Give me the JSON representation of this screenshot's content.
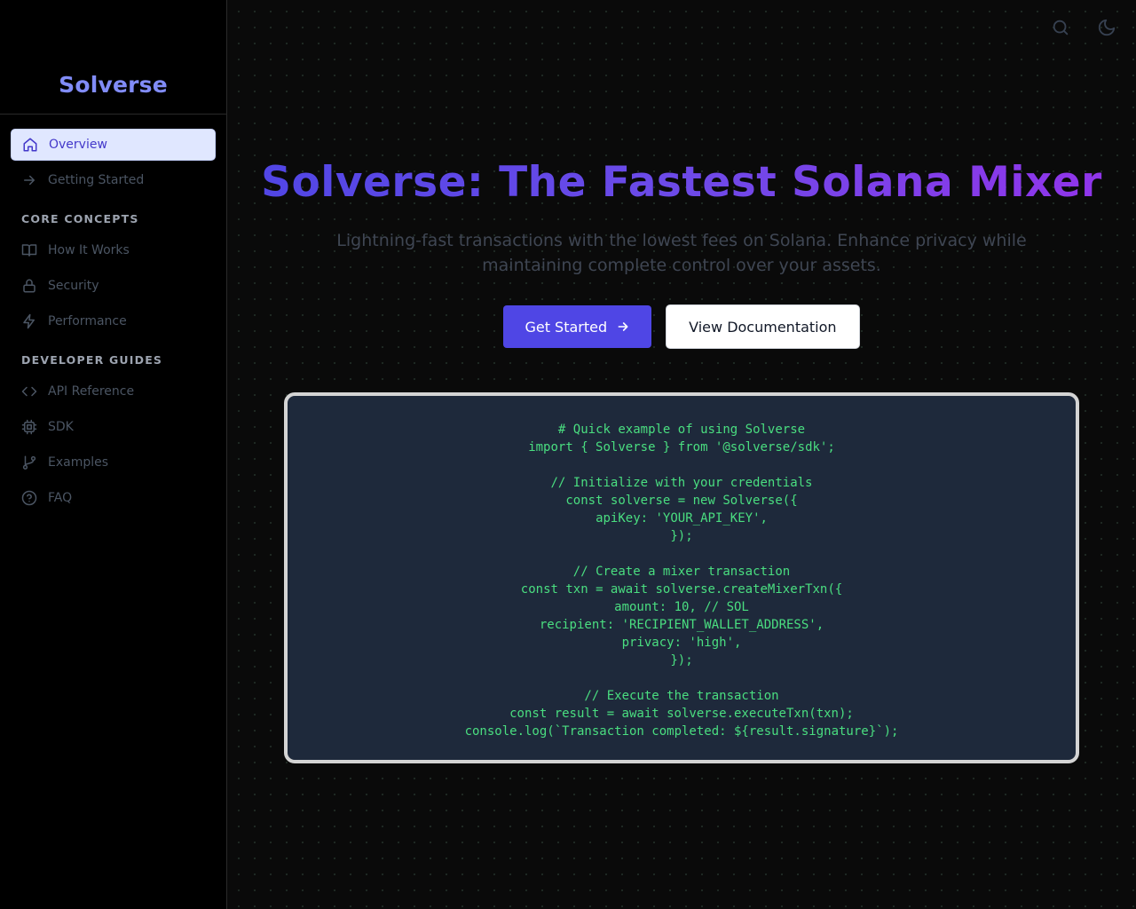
{
  "sidebar": {
    "brand": "Solverse",
    "top_items": [
      {
        "label": "Overview",
        "icon": "home-icon",
        "active": true
      },
      {
        "label": "Getting Started",
        "icon": "arrow-right-icon",
        "active": false
      }
    ],
    "sections": [
      {
        "title": "CORE CONCEPTS",
        "items": [
          {
            "label": "How It Works",
            "icon": "book-icon"
          },
          {
            "label": "Security",
            "icon": "lock-icon"
          },
          {
            "label": "Performance",
            "icon": "lightning-icon"
          }
        ]
      },
      {
        "title": "DEVELOPER GUIDES",
        "items": [
          {
            "label": "API Reference",
            "icon": "code-icon"
          },
          {
            "label": "SDK",
            "icon": "chip-icon"
          },
          {
            "label": "Examples",
            "icon": "git-branch-icon"
          },
          {
            "label": "FAQ",
            "icon": "help-circle-icon"
          }
        ]
      }
    ]
  },
  "header": {
    "icons": [
      "search-icon",
      "moon-icon"
    ]
  },
  "hero": {
    "title": "Solverse: The Fastest Solana Mixer",
    "subtitle": "Lightning-fast transactions with the lowest fees on Solana. Enhance privacy while maintaining complete control over your assets.",
    "primary_button": "Get Started",
    "secondary_button": "View Documentation"
  },
  "code": {
    "lines": [
      "# Quick example of using Solverse",
      "import { Solverse } from '@solverse/sdk';",
      "",
      "// Initialize with your credentials",
      "const solverse = new Solverse({",
      "apiKey: 'YOUR_API_KEY',",
      "});",
      "",
      "// Create a mixer transaction",
      "const txn = await solverse.createMixerTxn({",
      "amount: 10, // SOL",
      "recipient: 'RECIPIENT_WALLET_ADDRESS',",
      "privacy: 'high',",
      "});",
      "",
      "// Execute the transaction",
      "const result = await solverse.executeTxn(txn);",
      "console.log(`Transaction completed: ${result.signature}`);"
    ]
  },
  "colors": {
    "accent": "#4f46e5",
    "brand": "#818cf8",
    "code_text": "#4ade80",
    "code_bg": "#1e293b"
  }
}
